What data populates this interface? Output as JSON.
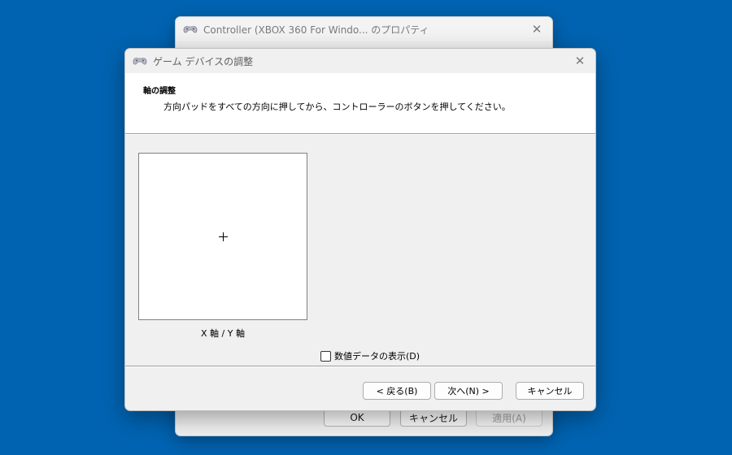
{
  "background_window": {
    "title": "Controller (XBOX 360 For Windo... のプロパティ",
    "icon": "game-controller-icon",
    "close_icon": "close-icon",
    "buttons": {
      "ok": "OK",
      "cancel": "キャンセル",
      "apply": "適用(A)"
    },
    "apply_enabled": false
  },
  "dialog": {
    "title": "ゲーム デバイスの調整",
    "icon": "game-controller-icon",
    "close_icon": "close-icon",
    "header": {
      "title": "軸の調整",
      "description": "方向パッドをすべての方向に押してから、コントローラーのボタンを押してください。"
    },
    "axis_label": "X 軸 / Y 軸",
    "show_raw_data_label": "数値データの表示(D)",
    "show_raw_data_checked": false,
    "buttons": {
      "back": "< 戻る(B)",
      "next": "次へ(N) >",
      "cancel": "キャンセル"
    }
  },
  "colors": {
    "desktop": "#0063b1",
    "window": "#f0f0f0",
    "header_band": "#ffffff"
  }
}
